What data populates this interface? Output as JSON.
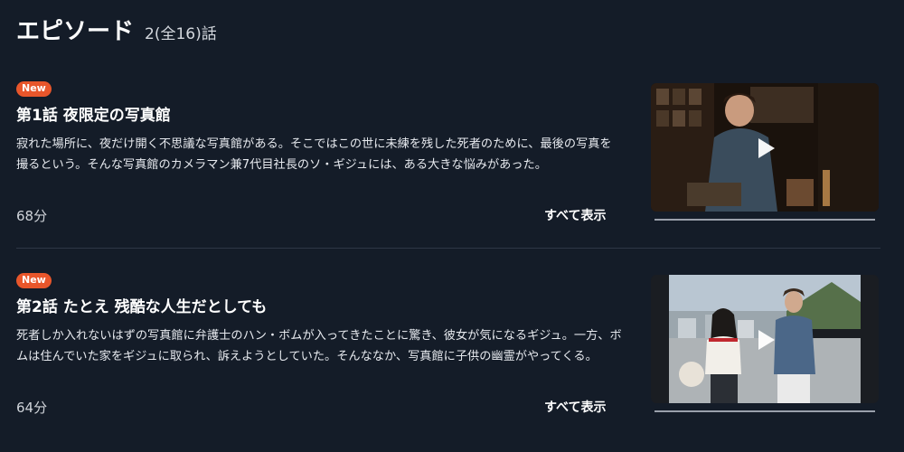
{
  "header": {
    "title": "エピソード",
    "count": "2(全16)話"
  },
  "episodes": [
    {
      "badge": "New",
      "title": "第1話 夜限定の写真館",
      "description": "寂れた場所に、夜だけ開く不思議な写真館がある。そこではこの世に未練を残した死者のために、最後の写真を撮るという。そんな写真館のカメラマン兼7代目社長のソ・ギジュには、ある大きな悩みがあった。",
      "duration": "68分",
      "show_all": "すべて表示"
    },
    {
      "badge": "New",
      "title": "第2話 たとえ 残酷な人生だとしても",
      "description": "死者しか入れないはずの写真館に弁護士のハン・ボムが入ってきたことに驚き、彼女が気になるギジュ。一方、ボムは住んでいた家をギジュに取られ、訴えようとしていた。そんななか、写真館に子供の幽霊がやってくる。",
      "duration": "64分",
      "show_all": "すべて表示"
    }
  ],
  "colors": {
    "background": "#141c28",
    "badge": "#e8562b",
    "divider": "#2e3746",
    "progress_track": "#9aa0ab"
  },
  "icons": [
    "play-icon"
  ]
}
